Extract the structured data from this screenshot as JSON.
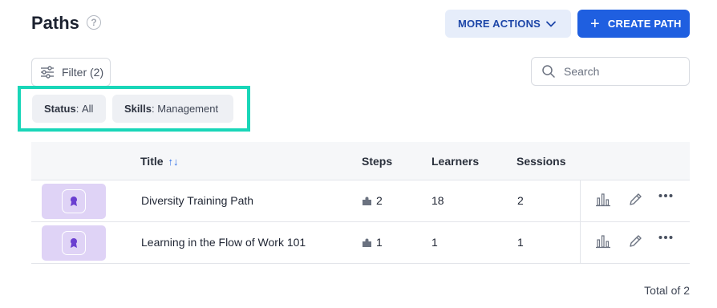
{
  "header": {
    "title": "Paths",
    "help_icon": "?",
    "more_actions_label": "MORE ACTIONS",
    "create_path_label": "CREATE PATH"
  },
  "toolbar": {
    "filter_label": "Filter (2)",
    "search_placeholder": "Search"
  },
  "chips": [
    {
      "key": "Status",
      "value": "All"
    },
    {
      "key": "Skills",
      "value": "Management"
    }
  ],
  "table": {
    "columns": [
      "Title",
      "Steps",
      "Learners",
      "Sessions"
    ],
    "sort_glyph": "↑↓",
    "rows": [
      {
        "title": "Diversity Training Path",
        "steps": "2",
        "learners": "18",
        "sessions": "2"
      },
      {
        "title": "Learning in the Flow of Work 101",
        "steps": "1",
        "learners": "1",
        "sessions": "1"
      }
    ]
  },
  "footer": {
    "total": "Total of 2"
  },
  "colors": {
    "accent": "#1f5fe0",
    "highlight": "#19d6b8",
    "thumbnail": "#dfd3f6"
  }
}
